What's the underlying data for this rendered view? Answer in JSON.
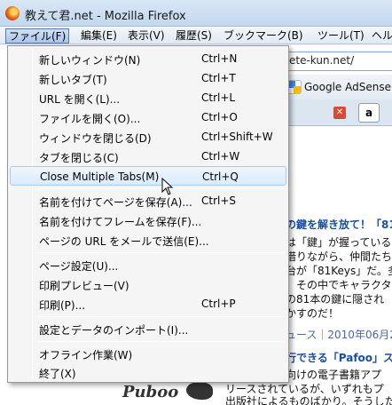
{
  "window": {
    "title": "教えて君.net - Mozilla Firefox"
  },
  "menubar": {
    "items": [
      {
        "label": "ファイル(F)"
      },
      {
        "label": "編集(E)"
      },
      {
        "label": "表示(V)"
      },
      {
        "label": "履歴(S)"
      },
      {
        "label": "ブックマーク(B)"
      },
      {
        "label": "ツール(T)"
      },
      {
        "label": "ヘル"
      }
    ]
  },
  "background": {
    "url": "ete-kun.net/",
    "bookmark": "Google AdSense",
    "amazon_tab": "a",
    "lines": [
      "の鍵を解き放て！「81K",
      "は「鍵」が握っている！",
      "借りながら、仲間たち",
      "台が「81Keys」だ。多種",
      "、その中でキャラクタ-",
      "の81本の鍵に隠され",
      "かすのだ！",
      "ュース｜2010年06月2",
      "行できる「Pafoo」ス",
      "向けの電子書籍アプ",
      "リースされているが、いずれもプ",
      "出版社によるものばかり。そうした"
    ],
    "logo": "Puboo"
  },
  "menu": {
    "items": [
      {
        "label": "新しいウィンドウ(N)",
        "shortcut": "Ctrl+N"
      },
      {
        "label": "新しいタブ(T)",
        "shortcut": "Ctrl+T"
      },
      {
        "label": "URL を開く(L)...",
        "shortcut": "Ctrl+L"
      },
      {
        "label": "ファイルを開く(O)...",
        "shortcut": "Ctrl+O"
      },
      {
        "label": "ウィンドウを閉じる(D)",
        "shortcut": "Ctrl+Shift+W"
      },
      {
        "label": "タブを閉じる(C)",
        "shortcut": "Ctrl+W"
      },
      {
        "label": "Close Multiple Tabs(M)",
        "shortcut": "Ctrl+Q"
      },
      {
        "label": "名前を付けてページを保存(A)...",
        "shortcut": "Ctrl+S"
      },
      {
        "label": "名前を付けてフレームを保存(F)...",
        "shortcut": ""
      },
      {
        "label": "ページの URL をメールで送信(E)...",
        "shortcut": ""
      },
      {
        "label": "ページ設定(U)...",
        "shortcut": ""
      },
      {
        "label": "印刷プレビュー(V)",
        "shortcut": ""
      },
      {
        "label": "印刷(P)...",
        "shortcut": "Ctrl+P"
      },
      {
        "label": "設定とデータのインポート(I)...",
        "shortcut": ""
      },
      {
        "label": "オフライン作業(W)",
        "shortcut": ""
      },
      {
        "label": "終了(X)",
        "shortcut": ""
      }
    ]
  }
}
